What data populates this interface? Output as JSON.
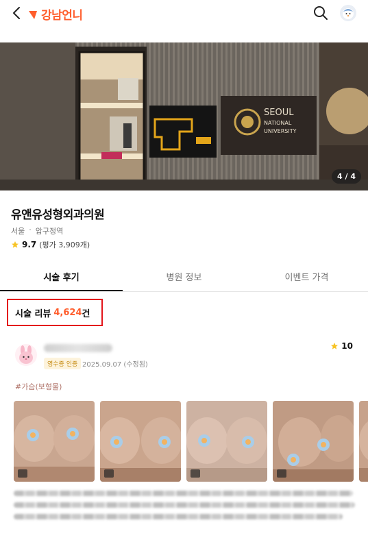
{
  "header": {
    "logo_text": "강남언니",
    "brand_color": "#ff5e2d"
  },
  "hero": {
    "pager": "4 / 4",
    "sign_text": [
      "SEOUL",
      "NATIONAL",
      "UNIVERSITY"
    ]
  },
  "hospital": {
    "name": "유앤유성형외과의원",
    "region": "서울",
    "separator": "·",
    "station": "압구정역",
    "score": "9.7",
    "review_count_text": "(평가 3,909개)"
  },
  "tabs": [
    {
      "label": "시술 후기",
      "active": true
    },
    {
      "label": "병원 정보",
      "active": false
    },
    {
      "label": "이벤트 가격",
      "active": false
    }
  ],
  "reviews_header": {
    "label": "시술 리뷰",
    "count": "4,624",
    "suffix": "건"
  },
  "review": {
    "badge": "영수증 인증",
    "date": "2025.09.07 (수정됨)",
    "score": "10",
    "tag": "#가슴(보형물)"
  },
  "icons": {
    "back": "back-arrow-icon",
    "search": "search-icon",
    "star": "star-icon",
    "camera": "camera-icon"
  }
}
